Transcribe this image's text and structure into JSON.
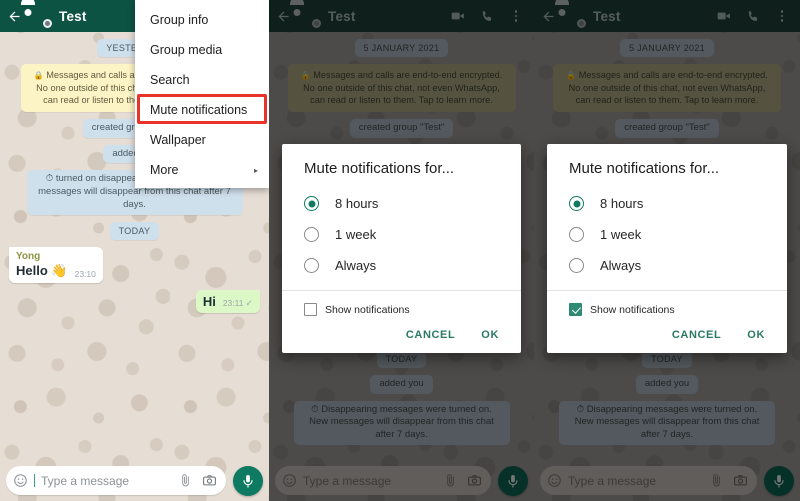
{
  "app": {
    "name": "WhatsApp"
  },
  "colors": {
    "appbar": "#0d5343",
    "accent": "#0f7a62",
    "highlight_red": "#e8322a",
    "out_bubble": "#dcf8c6",
    "chip_blue": "#cfe0ed",
    "encrypt_yellow": "#fdf4c5",
    "sender_olive": "#8c9440"
  },
  "header": {
    "title": "Test",
    "back_icon": "back-arrow-icon",
    "avatar_icon": "group-avatar",
    "video_icon": "video-call-icon",
    "phone_icon": "voice-call-icon",
    "menu_icon": "overflow-menu-icon"
  },
  "composer": {
    "placeholder": "Type a message",
    "emoji_icon": "emoji-icon",
    "attach_icon": "paperclip-icon",
    "camera_icon": "camera-icon",
    "mic_icon": "microphone-icon"
  },
  "panel1": {
    "messages": [
      {
        "kind": "date-chip",
        "text": "YESTERDAY"
      },
      {
        "kind": "encrypt-chip",
        "text": "Messages and calls are end-to-end encrypted. No one outside of this chat, not even WhatsApp, can read or listen to them. Tap to learn more."
      },
      {
        "kind": "system-chip",
        "text": "created group \"Test\""
      },
      {
        "kind": "system-chip",
        "text": "added you"
      },
      {
        "kind": "system-chip",
        "text": "turned on disappearing messages. New messages will disappear from this chat after 7 days."
      },
      {
        "kind": "date-chip",
        "text": "TODAY"
      }
    ],
    "incoming": {
      "sender": "Yong",
      "text": "Hello 👋",
      "time": "23:10"
    },
    "outgoing": {
      "text": "Hi",
      "time": "23:11",
      "status": "✓"
    }
  },
  "overflow_menu": {
    "items": [
      {
        "label": "Group info"
      },
      {
        "label": "Group media"
      },
      {
        "label": "Search"
      },
      {
        "label": "Mute notifications",
        "highlighted": true
      },
      {
        "label": "Wallpaper"
      },
      {
        "label": "More",
        "has_submenu": true
      }
    ],
    "submenu_arrow": "▸"
  },
  "chat_scrimmed": {
    "messages": [
      {
        "kind": "date-chip",
        "text": "5 JANUARY 2021"
      },
      {
        "kind": "encrypt-chip",
        "text": "Messages and calls are end-to-end encrypted. No one outside of this chat, not even WhatsApp, can read or listen to them. Tap to learn more."
      },
      {
        "kind": "system-chip",
        "text": "created group \"Test\""
      }
    ],
    "bottom_messages": [
      {
        "kind": "date-chip",
        "text": "TODAY"
      },
      {
        "kind": "system-chip",
        "text": "added you"
      },
      {
        "kind": "system-chip",
        "text": "Disappearing messages were turned on. New messages will disappear from this chat after 7 days."
      }
    ]
  },
  "dialog": {
    "title": "Mute notifications for...",
    "options": [
      {
        "label": "8 hours",
        "selected": true
      },
      {
        "label": "1 week",
        "selected": false
      },
      {
        "label": "Always",
        "selected": false
      }
    ],
    "checkbox_label": "Show notifications",
    "cancel_label": "CANCEL",
    "ok_label": "OK"
  },
  "panel2": {
    "show_notifications_checked": false
  },
  "panel3": {
    "show_notifications_checked": true
  }
}
